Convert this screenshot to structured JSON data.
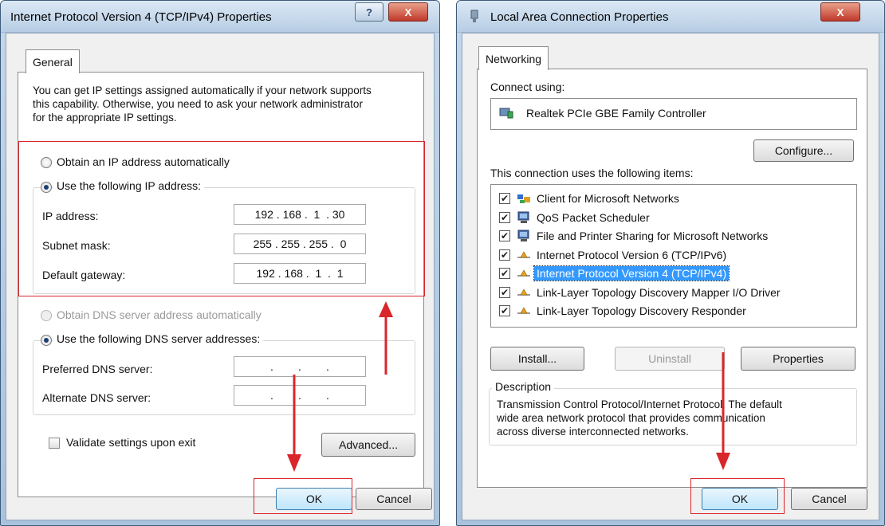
{
  "left_dialog": {
    "title": "Internet Protocol Version 4 (TCP/IPv4) Properties",
    "help_glyph": "?",
    "close_glyph": "X",
    "tab": "General",
    "intro": [
      "You can get IP settings assigned automatically if your network supports",
      "this capability. Otherwise, you need to ask your network administrator",
      "for the appropriate IP settings."
    ],
    "radio_auto_ip": "Obtain an IP address automatically",
    "radio_manual_ip": "Use the following IP address:",
    "ip_label": "IP address:",
    "ip_value": "192 . 168 .  1  . 30",
    "subnet_label": "Subnet mask:",
    "subnet_value": "255 . 255 . 255 .  0",
    "gateway_label": "Default gateway:",
    "gateway_value": "192 . 168 .  1  .  1",
    "radio_auto_dns": "Obtain DNS server address automatically",
    "radio_manual_dns": "Use the following DNS server addresses:",
    "preferred_dns_label": "Preferred DNS server:",
    "preferred_dns_value": ".        .        .",
    "alternate_dns_label": "Alternate DNS server:",
    "alternate_dns_value": ".        .        .",
    "validate_label": "Validate settings upon exit",
    "advanced_button": "Advanced...",
    "ok_button": "OK",
    "cancel_button": "Cancel"
  },
  "right_dialog": {
    "title": "Local Area Connection Properties",
    "close_glyph": "X",
    "tab": "Networking",
    "connect_using_label": "Connect using:",
    "adapter_name": "Realtek PCIe GBE Family Controller",
    "configure_button": "Configure...",
    "items_label": "This connection uses the following items:",
    "items": [
      {
        "label": "Client for Microsoft Networks",
        "checked": "✔",
        "icon": "network-client-icon"
      },
      {
        "label": "QoS Packet Scheduler",
        "checked": "✔",
        "icon": "computer-icon"
      },
      {
        "label": "File and Printer Sharing for Microsoft Networks",
        "checked": "✔",
        "icon": "computer-icon"
      },
      {
        "label": "Internet Protocol Version 6 (TCP/IPv6)",
        "checked": "✔",
        "icon": "protocol-icon"
      },
      {
        "label": "Internet Protocol Version 4 (TCP/IPv4)",
        "checked": "✔",
        "icon": "protocol-icon",
        "selected": true
      },
      {
        "label": "Link-Layer Topology Discovery Mapper I/O Driver",
        "checked": "✔",
        "icon": "protocol-icon"
      },
      {
        "label": "Link-Layer Topology Discovery Responder",
        "checked": "✔",
        "icon": "protocol-icon"
      }
    ],
    "install_button": "Install...",
    "uninstall_button": "Uninstall",
    "properties_button": "Properties",
    "description_title": "Description",
    "description_lines": [
      "Transmission Control Protocol/Internet Protocol. The default",
      "wide area network protocol that provides communication",
      "across diverse interconnected networks."
    ],
    "ok_button": "OK",
    "cancel_button": "Cancel"
  },
  "colors": {
    "highlight_red": "#d9262b",
    "selection_blue": "#3399ff"
  }
}
